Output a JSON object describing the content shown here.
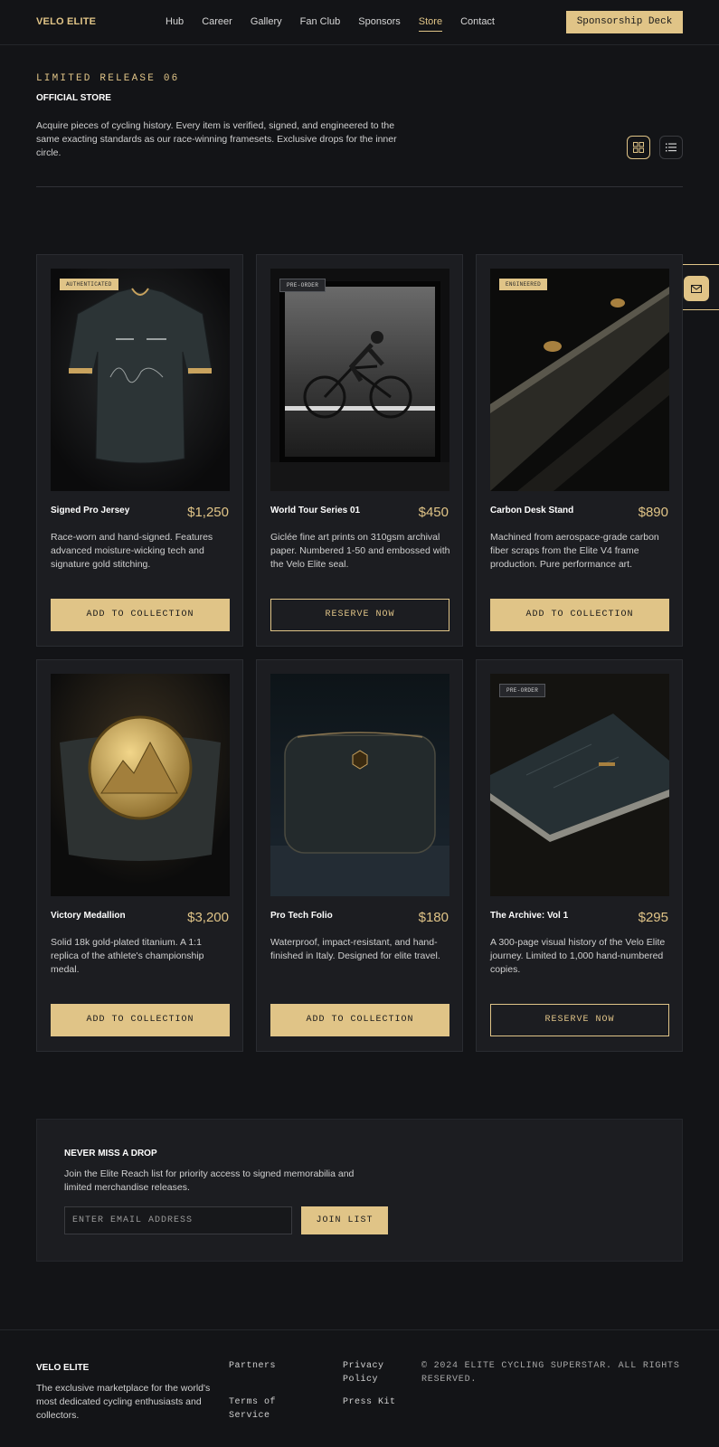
{
  "header": {
    "logo": "VELO ELITE",
    "nav": [
      "Hub",
      "Career",
      "Gallery",
      "Fan Club",
      "Sponsors",
      "Store",
      "Contact"
    ],
    "active_nav": "Store",
    "cta": "Sponsorship Deck"
  },
  "hero": {
    "eyebrow": "LIMITED RELEASE 06",
    "title": "OFFICIAL STORE",
    "intro": "Acquire pieces of cycling history. Every item is verified, signed, and engineered to the same exacting standards as our race-winning framesets. Exclusive drops for the inner circle.",
    "view_options": [
      "grid-view-icon",
      "list-view-icon"
    ]
  },
  "products": [
    {
      "badge": "AUTHENTICATED",
      "badge_style": "solid",
      "name": "Signed Pro Jersey",
      "price": "$1,250",
      "desc": "Race-worn and hand-signed. Features advanced moisture-wicking tech and signature gold stitching.",
      "cta": "ADD TO COLLECTION",
      "cta_style": "solid",
      "image": "jersey"
    },
    {
      "badge": "PRE-ORDER",
      "badge_style": "dark",
      "name": "World Tour Series 01",
      "price": "$450",
      "desc": "Giclée fine art prints on 310gsm archival paper. Numbered 1-50 and embossed with the Velo Elite seal.",
      "cta": "RESERVE NOW",
      "cta_style": "outline",
      "image": "print"
    },
    {
      "badge": "ENGINEERED",
      "badge_style": "solid",
      "name": "Carbon Desk Stand",
      "price": "$890",
      "desc": "Machined from aerospace-grade carbon fiber scraps from the Elite V4 frame production. Pure performance art.",
      "cta": "ADD TO COLLECTION",
      "cta_style": "solid",
      "image": "carbon"
    },
    {
      "badge": "",
      "badge_style": "none",
      "name": "Victory Medallion",
      "price": "$3,200",
      "desc": "Solid 18k gold-plated titanium. A 1:1 replica of the athlete's championship medal.",
      "cta": "ADD TO COLLECTION",
      "cta_style": "solid",
      "image": "medal"
    },
    {
      "badge": "",
      "badge_style": "none",
      "name": "Pro Tech Folio",
      "price": "$180",
      "desc": "Waterproof, impact-resistant, and hand-finished in Italy. Designed for elite travel.",
      "cta": "ADD TO COLLECTION",
      "cta_style": "solid",
      "image": "folio"
    },
    {
      "badge": "PRE-ORDER",
      "badge_style": "dark",
      "name": "The Archive: Vol 1",
      "price": "$295",
      "desc": "A 300-page visual history of the Velo Elite journey. Limited to 1,000 hand-numbered copies.",
      "cta": "RESERVE NOW",
      "cta_style": "outline",
      "image": "book"
    }
  ],
  "newsletter": {
    "title": "NEVER MISS A DROP",
    "text": "Join the Elite Reach list for priority access to signed memorabilia and limited merchandise releases.",
    "placeholder": "ENTER EMAIL ADDRESS",
    "button": "JOIN LIST"
  },
  "footer": {
    "brand": "VELO ELITE",
    "desc": "The exclusive marketplace for the world's most dedicated cycling enthusiasts and collectors.",
    "links": [
      "Partners",
      "Privacy Policy",
      "Terms of Service",
      "Press Kit"
    ],
    "copyright": "© 2024 ELITE CYCLING SUPERSTAR. ALL RIGHTS RESERVED."
  },
  "colors": {
    "accent": "#e0c487",
    "background": "#131417",
    "card": "#1c1d21"
  }
}
